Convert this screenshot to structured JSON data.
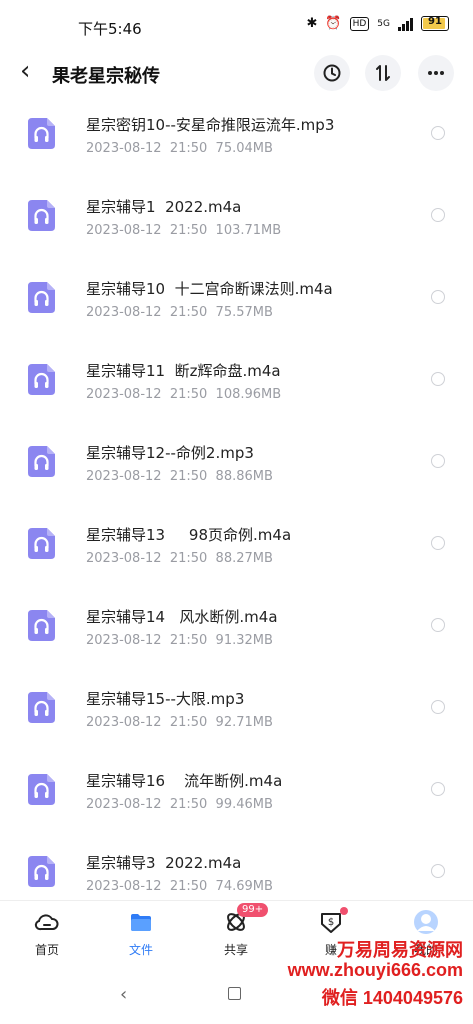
{
  "status": {
    "time": "下午5:46",
    "network": "5G",
    "hd": "HD",
    "battery": "91"
  },
  "header": {
    "title": "果老星宗秘传"
  },
  "files": [
    {
      "name": "星宗密钥10--安星命推限运流年.mp3",
      "meta": "2023-08-12  21:50  75.04MB"
    },
    {
      "name": "星宗辅导1  2022.m4a",
      "meta": "2023-08-12  21:50  103.71MB"
    },
    {
      "name": "星宗辅导10  十二宫命断课法则.m4a",
      "meta": "2023-08-12  21:50  75.57MB"
    },
    {
      "name": "星宗辅导11  断z辉命盘.m4a",
      "meta": "2023-08-12  21:50  108.96MB"
    },
    {
      "name": "星宗辅导12--命例2.mp3",
      "meta": "2023-08-12  21:50  88.86MB"
    },
    {
      "name": "星宗辅导13     98页命例.m4a",
      "meta": "2023-08-12  21:50  88.27MB"
    },
    {
      "name": "星宗辅导14   风水断例.m4a",
      "meta": "2023-08-12  21:50  91.32MB"
    },
    {
      "name": "星宗辅导15--大限.mp3",
      "meta": "2023-08-12  21:50  92.71MB"
    },
    {
      "name": "星宗辅导16    流年断例.m4a",
      "meta": "2023-08-12  21:50  99.46MB"
    },
    {
      "name": "星宗辅导3  2022.m4a",
      "meta": "2023-08-12  21:50  74.69MB"
    }
  ],
  "nav": {
    "home": "首页",
    "files": "文件",
    "share": "共享",
    "share_badge": "99+",
    "earn": "赚",
    "mine": "我的"
  },
  "watermark": {
    "line1": "万易周易资源网",
    "line2": "www.zhouyi666.com",
    "line3": "微信 1404049576"
  },
  "colors": {
    "accent": "#2f7cf6",
    "file_icon": "#8b86f0",
    "badge": "#f0506e",
    "watermark": "#e02020"
  }
}
